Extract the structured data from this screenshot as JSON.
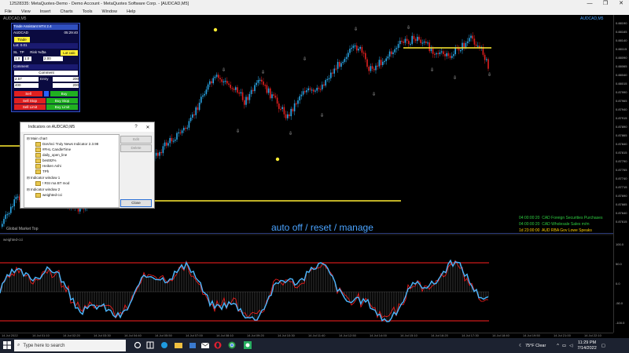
{
  "window": {
    "title": "12528335: MetaQuotes-Demo - Demo Account - MetaQuotes Software Corp. - [AUDCAD,M5]",
    "controls": [
      "—",
      "❐",
      "✕"
    ]
  },
  "menu": {
    "items": [
      "File",
      "View",
      "Insert",
      "Charts",
      "Tools",
      "Window",
      "Help"
    ]
  },
  "chart": {
    "symbol_label": "AUDCAD,M5",
    "right_label": "AUDCAD,M5",
    "indicator_label": "Global Market Top",
    "price_ticks": [
      "0.88190",
      "0.88165",
      "0.88140",
      "0.88115",
      "0.88090",
      "0.88065",
      "0.88040",
      "0.88015",
      "0.87990",
      "0.87965",
      "0.87940",
      "0.87915",
      "0.87890",
      "0.87865",
      "0.87840",
      "0.87815",
      "0.87790",
      "0.87765",
      "0.87740",
      "0.87715",
      "0.87690",
      "0.87665",
      "0.87640",
      "0.87615"
    ],
    "ind_ticks": [
      "100.0",
      "50.0",
      "0.0",
      "-50.0",
      "-100.0"
    ],
    "time_ticks": [
      "14 Jul 2022",
      "14 Jul 01:10",
      "14 Jul 02:20",
      "14 Jul 03:30",
      "14 Jul 04:40",
      "14 Jul 05:50",
      "14 Jul 07:00",
      "14 Jul 08:10",
      "14 Jul 09:20",
      "14 Jul 10:30",
      "14 Jul 11:40",
      "14 Jul 12:50",
      "14 Jul 14:00",
      "14 Jul 15:10",
      "14 Jul 16:20",
      "14 Jul 17:30",
      "14 Jul 18:40",
      "14 Jul 19:50",
      "14 Jul 21:00",
      "14 Jul 22:10"
    ],
    "overlay_text": "auto off / reset / manage",
    "colors": {
      "bull": "#2aa6e6",
      "bear": "#e02020",
      "hline": "#ffee33",
      "ind_line": "#4ab7ff",
      "ind_red": "#ff2020"
    }
  },
  "trade_panel": {
    "title": "Trade Assistant MT4 2.4",
    "symbol": "AUDCAD",
    "time": "05:29:40",
    "trade_btn": "Trade",
    "lot_label": "Lot: 0.01",
    "risk_label": "Risk %/$a",
    "lot_calc_btn": "Lot calc",
    "sl_label": "SL",
    "tp_label": "TP",
    "sl_val": "1.0",
    "tp_val": "1.0",
    "risk_val": "2.00",
    "comment_label": "Comment",
    "comment_val": "Comment",
    "entry_label": "Entry",
    "entry_val": "200",
    "sl_pts": "2.57",
    "tp_pts": "400",
    "tp_val2": "200",
    "sell_btn": "Sell",
    "buy_btn": "Buy",
    "sell_stop_btn": "Sell Stop",
    "buy_stop_btn": "Buy Stop",
    "sell_limit_btn": "Sell Limit",
    "buy_limit_btn": "Buy Limit"
  },
  "dialog": {
    "title": "Indicators on AUDCAD,M5",
    "help": "?",
    "close_x": "✕",
    "tree": {
      "main": "Main chart",
      "main_items": [
        "DaVinci Truly News Indicator 2.3.98",
        "#FHL CandleTime",
        "daily_open_line",
        "best82%",
        "Heiken Ashi",
        "TPh"
      ],
      "win1": "Indicator window 1",
      "win1_items": [
        "! RSI ma BT mod"
      ],
      "win2": "Indicator window 2",
      "win2_items": [
        "weighted-cci"
      ]
    },
    "edit_btn": "Edit",
    "delete_btn": "Delete",
    "close_btn": "Close"
  },
  "news": [
    {
      "time": "04:00:00:20",
      "text": "CAD Foreign Securities Purchases",
      "color": "#2ecc40"
    },
    {
      "time": "04:00:00:20",
      "text": "CAD Wholesale Sales m/m",
      "color": "#2ecc40"
    },
    {
      "time": "1d 23:00:00",
      "text": "AUD RBA Gov Lowe Speaks",
      "color": "#ffcc00"
    }
  ],
  "taskbar": {
    "search_placeholder": "Type here to search",
    "weather": "75°F Clear",
    "time": "11:29 PM",
    "date": "7/14/2022"
  }
}
